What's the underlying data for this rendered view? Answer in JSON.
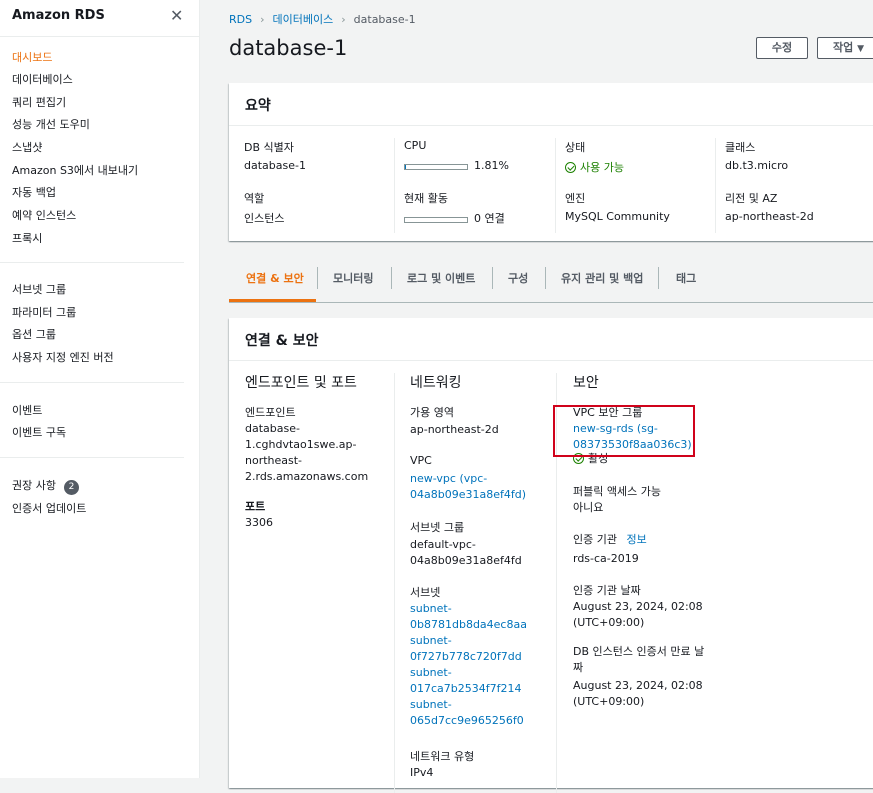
{
  "sidebar": {
    "title": "Amazon RDS",
    "group1": [
      "대시보드",
      "데이터베이스",
      "쿼리 편집기",
      "성능 개선 도우미",
      "스냅샷",
      "Amazon S3에서 내보내기",
      "자동 백업",
      "예약 인스턴스",
      "프록시"
    ],
    "group2": [
      "서브넷 그룹",
      "파라미터 그룹",
      "옵션 그룹",
      "사용자 지정 엔진 버전"
    ],
    "group3": [
      "이벤트",
      "이벤트 구독"
    ],
    "group4": {
      "recommendations": "권장 사항",
      "recommendations_count": "2",
      "cert_update": "인증서 업데이트"
    }
  },
  "breadcrumb": {
    "rds": "RDS",
    "databases": "데이터베이스",
    "current": "database-1"
  },
  "page": {
    "title": "database-1",
    "modify_button": "수정",
    "actions_button": "작업"
  },
  "summary": {
    "heading": "요약",
    "db_identifier_label": "DB 식별자",
    "db_identifier": "database-1",
    "cpu_label": "CPU",
    "cpu_value": "1.81%",
    "cpu_fraction": 0.0181,
    "status_label": "상태",
    "status_value": "사용 가능",
    "class_label": "클래스",
    "class_value": "db.t3.micro",
    "role_label": "역할",
    "role_value": "인스턴스",
    "activity_label": "현재 활동",
    "activity_value": "0 연결",
    "engine_label": "엔진",
    "engine_value": "MySQL Community",
    "region_label": "리전 및 AZ",
    "region_value": "ap-northeast-2d"
  },
  "tabs": [
    "연결 & 보안",
    "모니터링",
    "로그 및 이벤트",
    "구성",
    "유지 관리 및 백업",
    "태그"
  ],
  "conn": {
    "heading": "연결 & 보안",
    "endpoint_col": {
      "title": "엔드포인트 및 포트",
      "endpoint_label": "엔드포인트",
      "endpoint_lines": [
        "database-",
        "1.cghdvtao1swe.ap-",
        "northeast-",
        "2.rds.amazonaws.com"
      ],
      "port_label": "포트",
      "port_value": "3306"
    },
    "network_col": {
      "title": "네트워킹",
      "az_label": "가용 영역",
      "az_value": "ap-northeast-2d",
      "vpc_label": "VPC",
      "vpc_lines": [
        "new-vpc (vpc-",
        "04a8b09e31a8ef4fd)"
      ],
      "subnet_group_label": "서브넷 그룹",
      "subnet_group_lines": [
        "default-vpc-",
        "04a8b09e31a8ef4fd"
      ],
      "subnets_label": "서브넷",
      "subnet_lines": [
        "subnet-",
        "0b8781db8da4ec8aa",
        "subnet-",
        "0f727b778c720f7dd",
        "subnet-",
        "017ca7b2534f7f214",
        "subnet-",
        "065d7cc9e965256f0"
      ],
      "network_type_label": "네트워크 유형",
      "network_type_value": "IPv4"
    },
    "security_col": {
      "title": "보안",
      "sg_label": "VPC 보안 그룹",
      "sg_lines": [
        "new-sg-rds (sg-",
        "08373530f8aa036c3)"
      ],
      "sg_status": "활성",
      "public_label": "퍼블릭 액세스 가능",
      "public_value": "아니요",
      "ca_label": "인증 기관",
      "ca_info": "정보",
      "ca_value": "rds-ca-2019",
      "ca_date_label": "인증 기관 날짜",
      "ca_date_lines": [
        "August 23, 2024, 02:08",
        "(UTC+09:00)"
      ],
      "cert_exp_label_lines": [
        "DB 인스턴스 인증서 만료 날",
        "짜"
      ],
      "cert_exp_lines": [
        "August 23, 2024, 02:08",
        "(UTC+09:00)"
      ]
    }
  }
}
